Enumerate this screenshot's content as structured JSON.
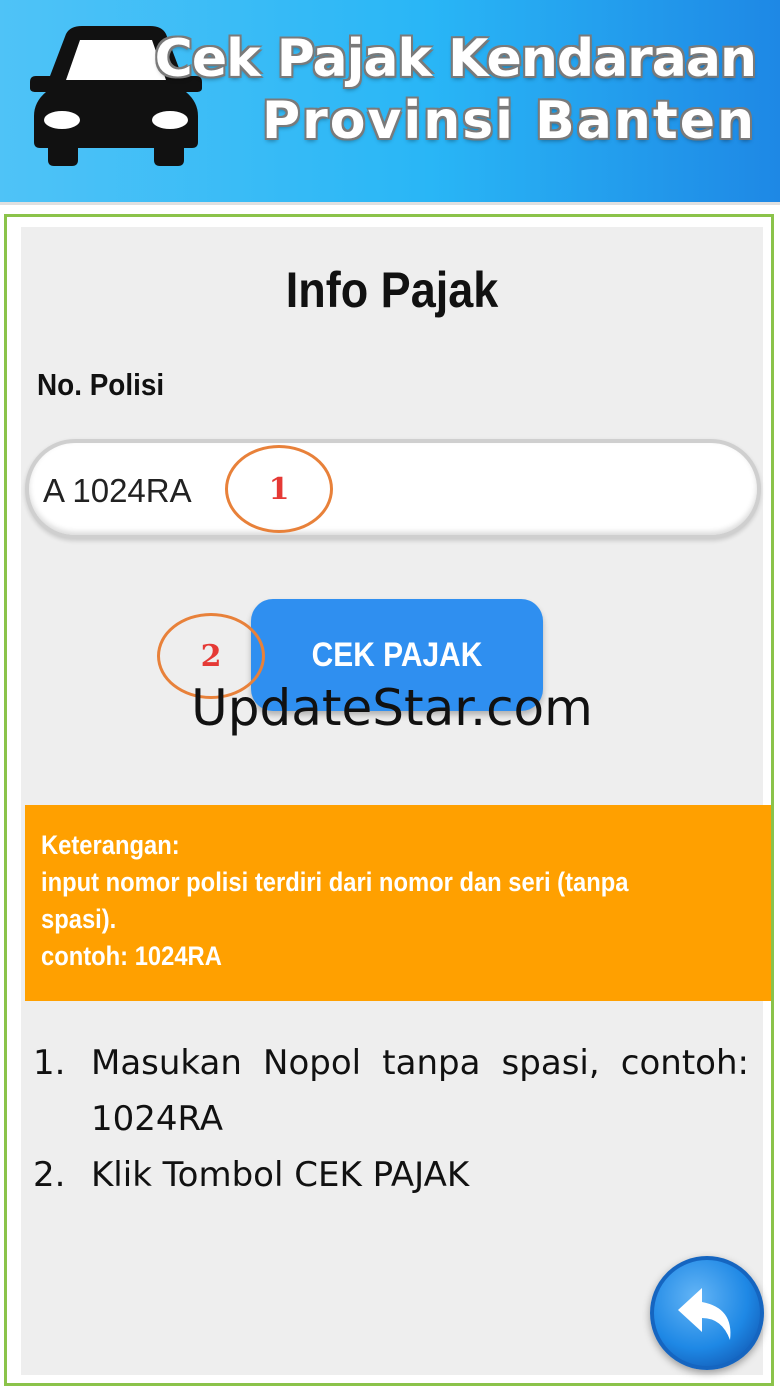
{
  "banner": {
    "line1": "Cek Pajak Kendaraan",
    "line2": "Provinsi Banten",
    "icon": "car-icon"
  },
  "form": {
    "title": "Info Pajak",
    "field_label": "No. Polisi",
    "plate_value": "A 1024RA",
    "button_label": "CEK PAJAK"
  },
  "markers": [
    "1",
    "2"
  ],
  "watermark": "UpdateStar.com",
  "info": {
    "line1": "Keterangan:",
    "line2": "input nomor polisi terdiri dari nomor dan seri (tanpa",
    "line3": "spasi).",
    "line4": "contoh: 1024RA"
  },
  "steps": [
    {
      "num": "1.",
      "text": "Masukan Nopol tanpa spasi, contoh: 1024RA"
    },
    {
      "num": "2.",
      "text": "Klik Tombol CEK PAJAK"
    }
  ],
  "back_button": {
    "icon": "back-arrow-icon"
  },
  "colors": {
    "banner": "#29b6f6",
    "button": "#2f8ff0",
    "info_box": "#ffa000",
    "frame_border": "#8bc34a",
    "marker_ring": "#e8813a",
    "marker_text": "#e53935"
  }
}
